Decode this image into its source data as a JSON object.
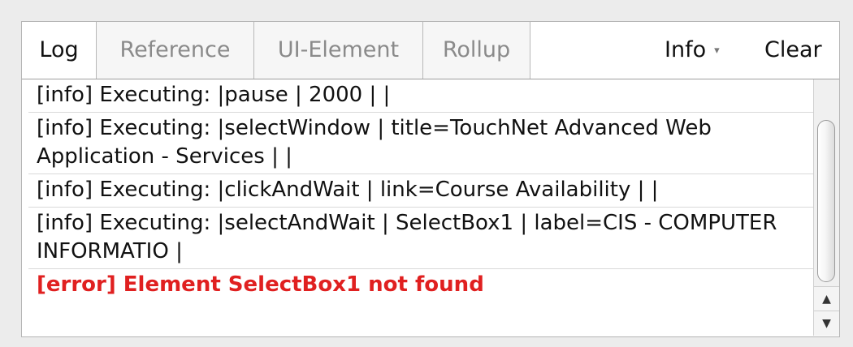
{
  "tabs": [
    {
      "label": "Log",
      "active": true
    },
    {
      "label": "Reference",
      "active": false
    },
    {
      "label": "UI-Element",
      "active": false
    },
    {
      "label": "Rollup",
      "active": false
    }
  ],
  "toolbar": {
    "info_label": "Info",
    "info_arrow": "▾",
    "clear_label": "Clear"
  },
  "log_entries": [
    {
      "level": "info",
      "text": "[info] Executing: |pause | 2000 | |"
    },
    {
      "level": "info",
      "text": "[info] Executing: |selectWindow | title=TouchNet Advanced Web Application - Services | |"
    },
    {
      "level": "info",
      "text": "[info] Executing: |clickAndWait | link=Course Availability | |"
    },
    {
      "level": "info",
      "text": "[info] Executing: |selectAndWait | SelectBox1 | label=CIS - COMPUTER INFORMATIO |"
    },
    {
      "level": "error",
      "text": "[error] Element SelectBox1 not found"
    }
  ],
  "scrollbar": {
    "up_arrow": "▲",
    "down_arrow": "▼"
  },
  "colors": {
    "error": "#e02020",
    "background": "#ececec",
    "panel": "#ffffff"
  }
}
